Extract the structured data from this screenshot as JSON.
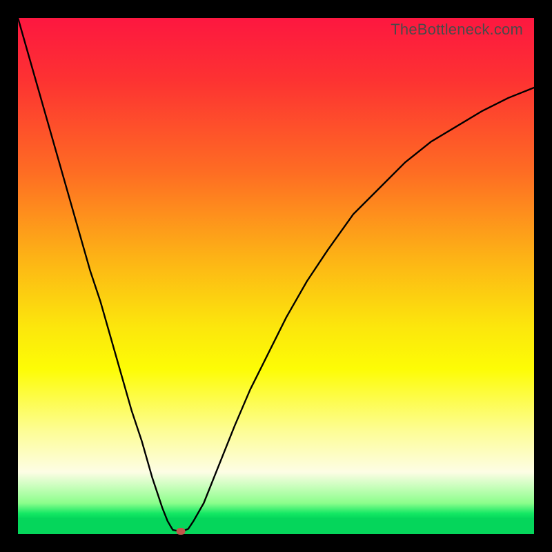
{
  "watermark": "TheBottleneck.com",
  "colors": {
    "frame": "#000000",
    "gradient_top": "#fd1740",
    "gradient_bottom": "#05d65b",
    "curve": "#000000",
    "marker": "#c0564a"
  },
  "chart_data": {
    "type": "line",
    "title": "",
    "xlabel": "",
    "ylabel": "",
    "xlim": [
      0,
      100
    ],
    "ylim": [
      0,
      100
    ],
    "grid": false,
    "curve": {
      "x": [
        0,
        2,
        4,
        6,
        8,
        10,
        12,
        14,
        16,
        18,
        20,
        22,
        24,
        26,
        27,
        28,
        29,
        30,
        31,
        32,
        33,
        34,
        36,
        38,
        40,
        42,
        45,
        48,
        52,
        56,
        60,
        65,
        70,
        75,
        80,
        85,
        90,
        95,
        100
      ],
      "y": [
        100,
        93,
        86,
        79,
        72,
        65,
        58,
        51,
        45,
        38,
        31,
        24,
        18,
        11,
        8,
        5,
        2.5,
        0.8,
        0.6,
        0.6,
        1.0,
        2.5,
        6,
        11,
        16,
        21,
        28,
        34,
        42,
        49,
        55,
        62,
        67,
        72,
        76,
        79,
        82,
        84.5,
        86.5
      ]
    },
    "marker_point": {
      "x": 31.5,
      "y": 0.5
    }
  }
}
